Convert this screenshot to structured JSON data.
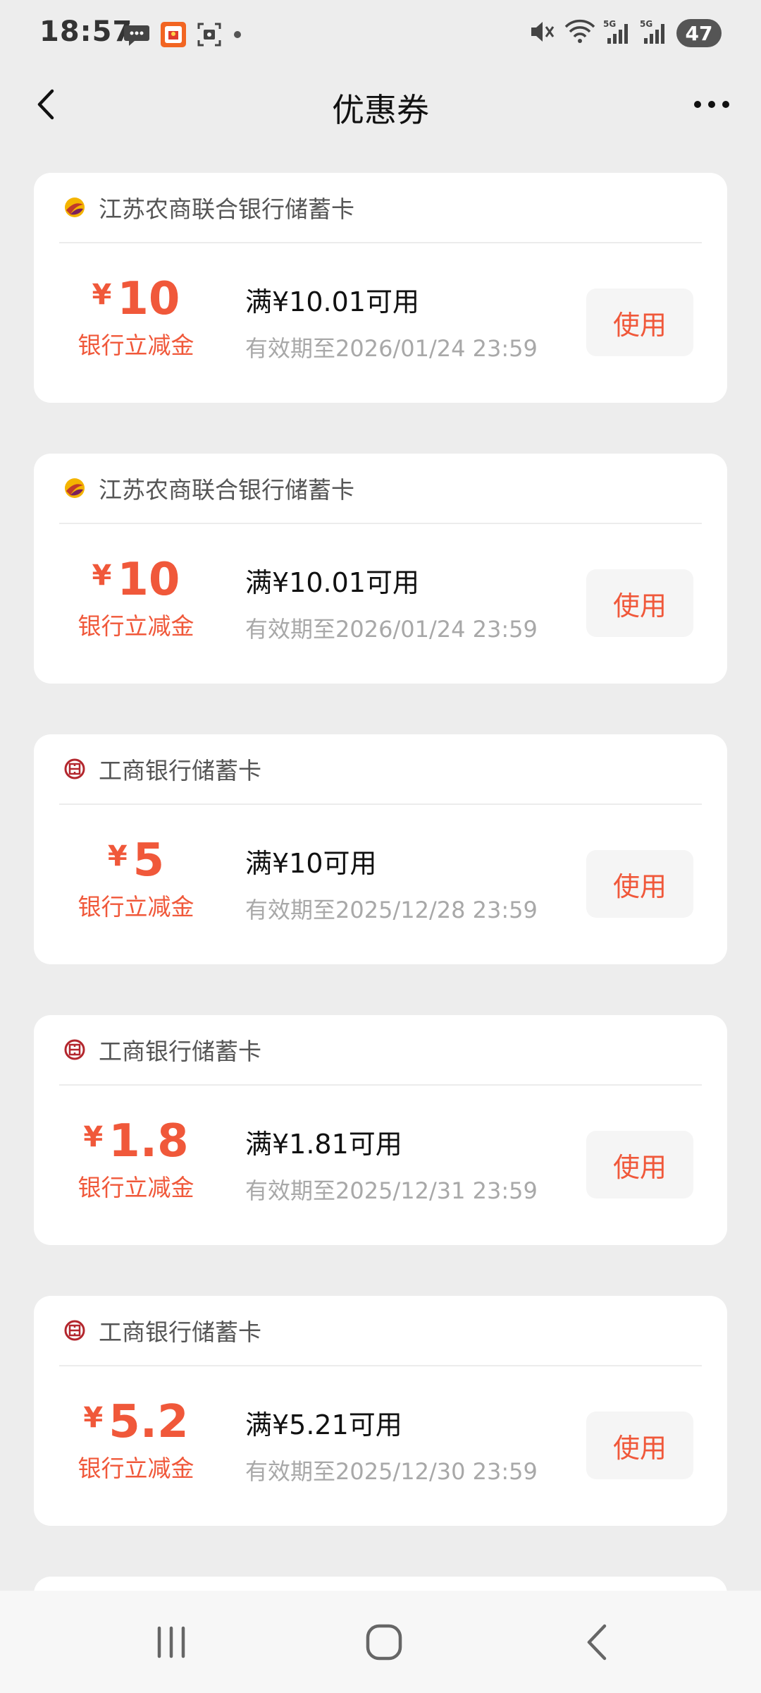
{
  "status_bar": {
    "time": "18:57",
    "battery": "47",
    "left_icons": [
      "chat-bubble-icon",
      "red-app-icon",
      "screenshot-icon",
      "dot-icon"
    ],
    "right_icons": [
      "mute-icon",
      "wifi-icon",
      "signal-5g-icon",
      "signal-5g-icon"
    ]
  },
  "header": {
    "title": "优惠券"
  },
  "coupons": [
    {
      "bank": "江苏农商联合银行储蓄卡",
      "currency": "¥",
      "amount": "10",
      "label": "银行立减金",
      "condition": "满¥10.01可用",
      "expiry": "有效期至2026/01/24 23:59",
      "button": "使用",
      "logo": "jiangsu-bank-logo-icon"
    },
    {
      "bank": "江苏农商联合银行储蓄卡",
      "currency": "¥",
      "amount": "10",
      "label": "银行立减金",
      "condition": "满¥10.01可用",
      "expiry": "有效期至2026/01/24 23:59",
      "button": "使用",
      "logo": "jiangsu-bank-logo-icon"
    },
    {
      "bank": "工商银行储蓄卡",
      "currency": "¥",
      "amount": "5",
      "label": "银行立减金",
      "condition": "满¥10可用",
      "expiry": "有效期至2025/12/28 23:59",
      "button": "使用",
      "logo": "icbc-logo-icon"
    },
    {
      "bank": "工商银行储蓄卡",
      "currency": "¥",
      "amount": "1.8",
      "label": "银行立减金",
      "condition": "满¥1.81可用",
      "expiry": "有效期至2025/12/31 23:59",
      "button": "使用",
      "logo": "icbc-logo-icon"
    },
    {
      "bank": "工商银行储蓄卡",
      "currency": "¥",
      "amount": "5.2",
      "label": "银行立减金",
      "condition": "满¥5.21可用",
      "expiry": "有效期至2025/12/30 23:59",
      "button": "使用",
      "logo": "icbc-logo-icon"
    }
  ],
  "colors": {
    "accent": "#f0583a",
    "background": "#ededed",
    "card": "#ffffff",
    "muted_text": "#a8a8a8"
  },
  "nav": {
    "items": [
      "recent-apps-icon",
      "home-icon",
      "back-icon"
    ]
  }
}
